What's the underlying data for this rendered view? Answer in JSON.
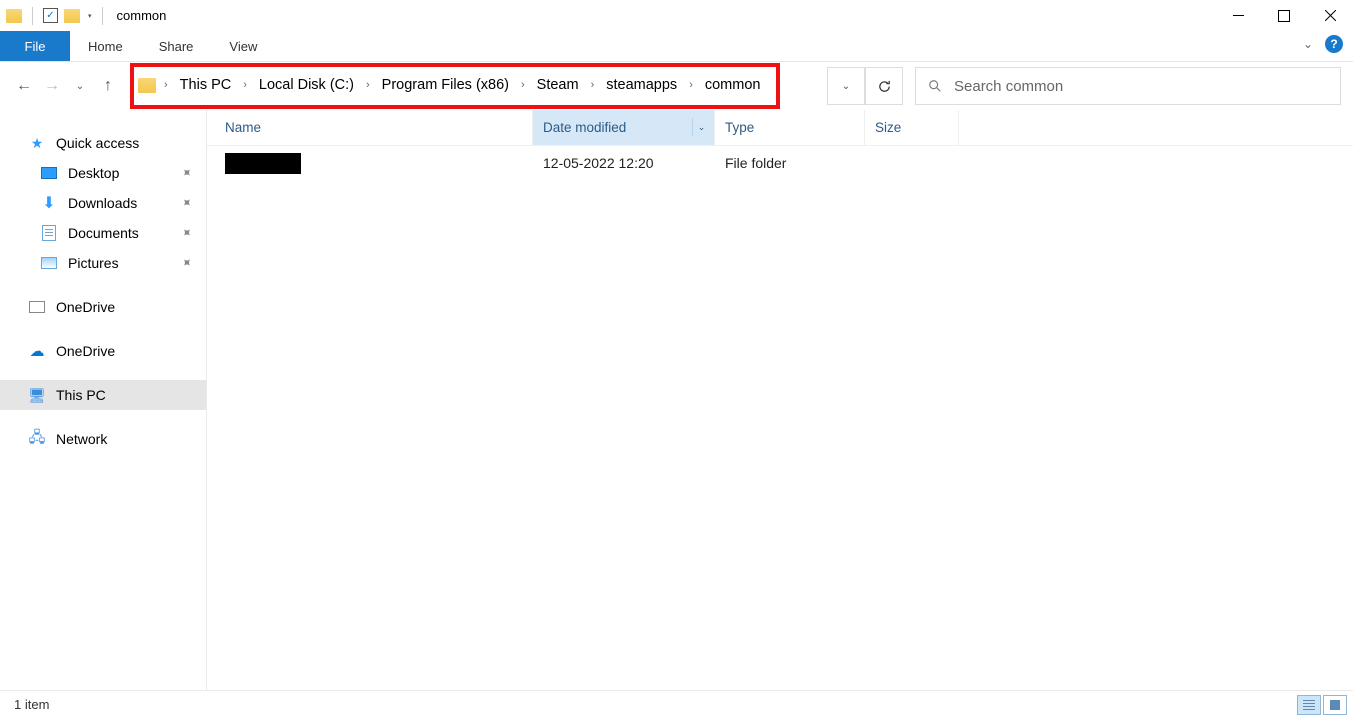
{
  "title": "common",
  "ribbon": {
    "file": "File",
    "tabs": [
      "Home",
      "Share",
      "View"
    ]
  },
  "breadcrumb": [
    "This PC",
    "Local Disk (C:)",
    "Program Files (x86)",
    "Steam",
    "steamapps",
    "common"
  ],
  "search": {
    "placeholder": "Search common"
  },
  "sidebar": {
    "quick_access": "Quick access",
    "quick_items": [
      {
        "label": "Desktop",
        "pinned": true
      },
      {
        "label": "Downloads",
        "pinned": true
      },
      {
        "label": "Documents",
        "pinned": true
      },
      {
        "label": "Pictures",
        "pinned": true
      }
    ],
    "onedrive1": "OneDrive",
    "onedrive2": "OneDrive",
    "this_pc": "This PC",
    "network": "Network"
  },
  "columns": {
    "name": "Name",
    "date": "Date modified",
    "type": "Type",
    "size": "Size"
  },
  "rows": [
    {
      "name": "",
      "redacted": true,
      "date": "12-05-2022 12:20",
      "type": "File folder",
      "size": ""
    }
  ],
  "status": {
    "count": "1 item"
  }
}
